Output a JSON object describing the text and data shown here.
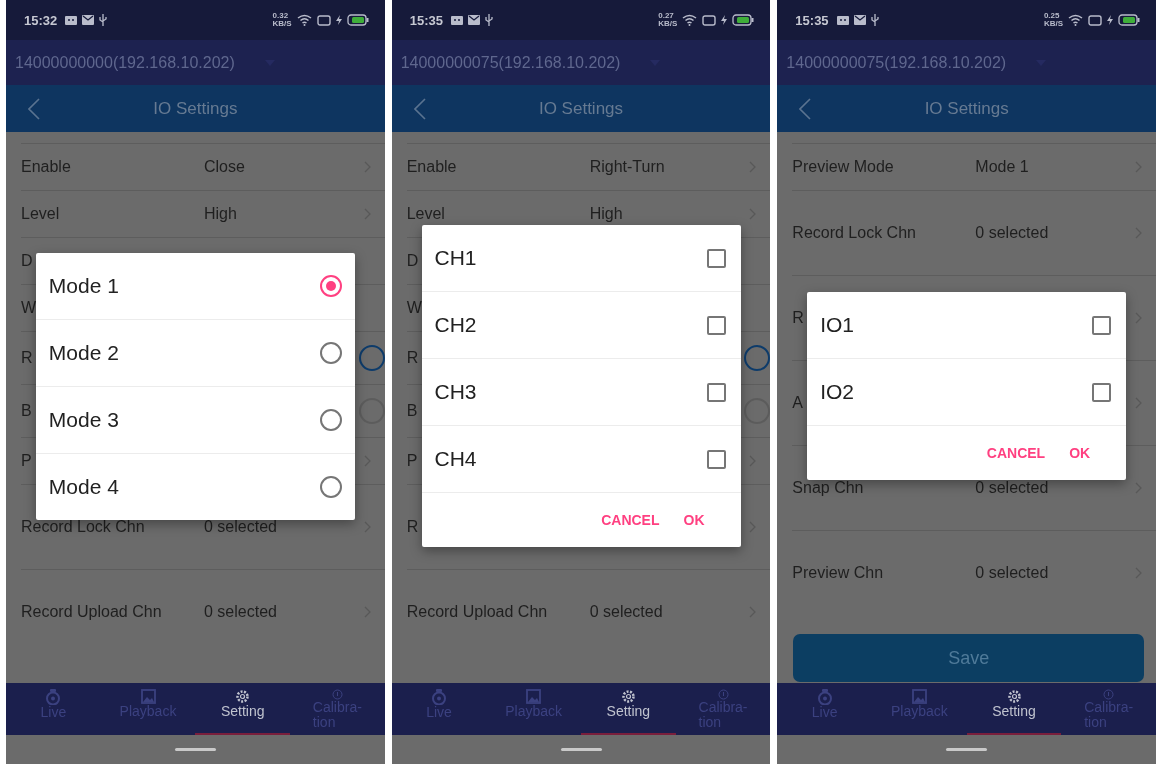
{
  "screens": [
    {
      "status": {
        "time": "15:32",
        "speed": "0.32\nKB/S"
      },
      "device": "14000000000(192.168.10.202)",
      "title": "IO Settings",
      "rows": [
        {
          "kind": "arrow",
          "label": "Enable",
          "value": "Close"
        },
        {
          "kind": "arrow",
          "label": "Level",
          "value": "High"
        },
        {
          "kind": "plain",
          "label": "D"
        },
        {
          "kind": "plain",
          "label": "W"
        },
        {
          "kind": "switch",
          "label": "R",
          "on": true
        },
        {
          "kind": "switch",
          "label": "B",
          "on": false
        },
        {
          "kind": "arrow",
          "label": "P"
        },
        {
          "kind": "multi",
          "label": "Record Lock Chn",
          "value": "0 selected"
        },
        {
          "kind": "multi",
          "label": "Record Upload Chn",
          "value": "0 selected"
        }
      ],
      "dialog": {
        "kind": "radio",
        "options": [
          {
            "label": "Mode 1",
            "selected": true
          },
          {
            "label": "Mode 2",
            "selected": false
          },
          {
            "label": "Mode 3",
            "selected": false
          },
          {
            "label": "Mode 4",
            "selected": false
          }
        ]
      },
      "nav": [
        {
          "label": "Live",
          "selected": false
        },
        {
          "label": "Playback",
          "selected": false
        },
        {
          "label": "Setting",
          "selected": true
        },
        {
          "label": "Calibra-\ntion",
          "selected": false
        }
      ]
    },
    {
      "status": {
        "time": "15:35",
        "speed": "0.27\nKB/S"
      },
      "device": "14000000075(192.168.10.202)",
      "title": "IO Settings",
      "rows": [
        {
          "kind": "arrow",
          "label": "Enable",
          "value": "Right-Turn"
        },
        {
          "kind": "arrow",
          "label": "Level",
          "value": "High"
        },
        {
          "kind": "plain",
          "label": "D"
        },
        {
          "kind": "plain",
          "label": "W"
        },
        {
          "kind": "switch",
          "label": "R",
          "on": true
        },
        {
          "kind": "switch",
          "label": "B",
          "on": false
        },
        {
          "kind": "arrow",
          "label": "P"
        },
        {
          "kind": "multi",
          "label": "R"
        },
        {
          "kind": "multi",
          "label": "Record Upload Chn",
          "value": "0 selected"
        }
      ],
      "dialog": {
        "kind": "check",
        "options": [
          {
            "label": "CH1",
            "checked": false
          },
          {
            "label": "CH2",
            "checked": false
          },
          {
            "label": "CH3",
            "checked": false
          },
          {
            "label": "CH4",
            "checked": false
          }
        ],
        "buttons": [
          "CANCEL",
          "OK"
        ]
      },
      "nav": [
        {
          "label": "Live",
          "selected": false
        },
        {
          "label": "Playback",
          "selected": false
        },
        {
          "label": "Setting",
          "selected": true
        },
        {
          "label": "Calibra-\ntion",
          "selected": false
        }
      ]
    },
    {
      "status": {
        "time": "15:35",
        "speed": "0.25\nKB/S"
      },
      "device": "14000000075(192.168.10.202)",
      "title": "IO Settings",
      "rows": [
        {
          "kind": "arrow",
          "label": "Preview Mode",
          "value": "Mode 1"
        },
        {
          "kind": "multi",
          "label": "Record Lock Chn",
          "value": "0 selected"
        },
        {
          "kind": "multi",
          "label": "R"
        },
        {
          "kind": "multi",
          "label": "A"
        },
        {
          "kind": "multi",
          "label": "Snap Chn",
          "value": "0 selected"
        },
        {
          "kind": "multi",
          "label": "Preview Chn",
          "value": "0 selected"
        }
      ],
      "save_button": "Save",
      "dialog": {
        "kind": "check",
        "options": [
          {
            "label": "IO1",
            "checked": false
          },
          {
            "label": "IO2",
            "checked": false
          }
        ],
        "buttons": [
          "CANCEL",
          "OK"
        ]
      },
      "nav": [
        {
          "label": "Live",
          "selected": false
        },
        {
          "label": "Playback",
          "selected": false
        },
        {
          "label": "Setting",
          "selected": true
        },
        {
          "label": "Calibra-\ntion",
          "selected": false
        }
      ]
    }
  ]
}
